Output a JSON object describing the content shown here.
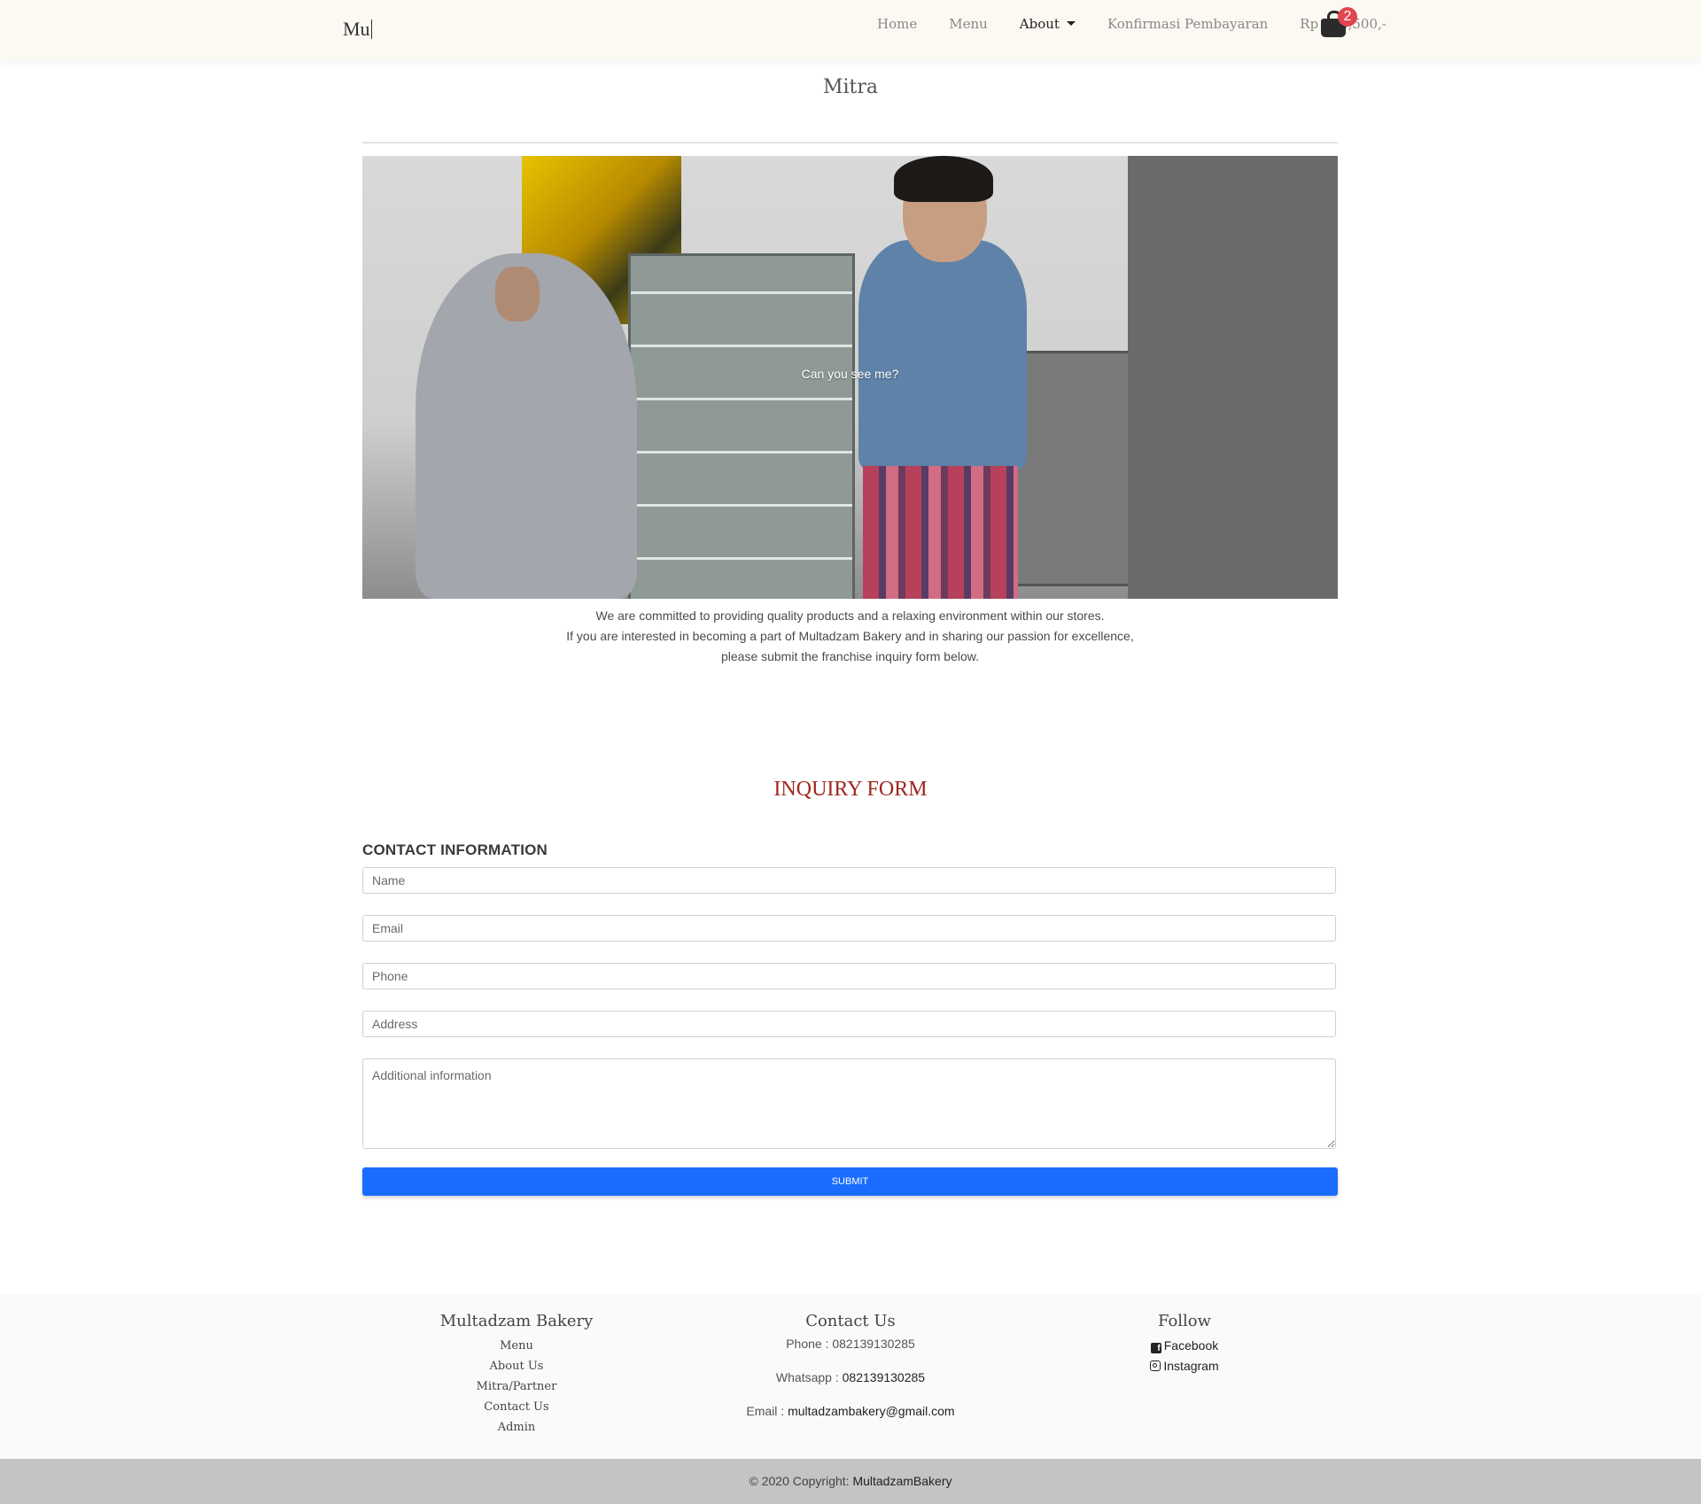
{
  "navbar": {
    "brand": "Mu",
    "items": [
      {
        "label": "Home"
      },
      {
        "label": "Menu"
      },
      {
        "label": "About"
      },
      {
        "label": "Konfirmasi Pembayaran"
      }
    ],
    "cart_total": "Rp 122,500,-",
    "cart_count": "2"
  },
  "page": {
    "title": "Mitra",
    "hero_caption": "Can you see me?",
    "intro_lines": [
      "We are committed to providing quality products and a relaxing environment within our stores.",
      "If you are interested in becoming a part of Multadzam Bakery and in sharing our passion for excellence,",
      "please submit the franchise inquiry form below."
    ]
  },
  "form": {
    "title": "INQUIRY FORM",
    "section_label": "CONTACT INFORMATION",
    "placeholders": {
      "name": "Name",
      "email": "Email",
      "phone": "Phone",
      "address": "Address",
      "additional": "Additional information"
    },
    "submit_label": "SUBMIT"
  },
  "footer": {
    "col1": {
      "title": "Multadzam Bakery",
      "links": [
        "Menu",
        "About Us",
        "Mitra/Partner",
        "Contact Us",
        "Admin"
      ]
    },
    "col2": {
      "title": "Contact Us",
      "phone_label": "Phone :",
      "phone": "082139130285",
      "whatsapp_label": "Whatsapp :",
      "whatsapp": "082139130285",
      "email_label": "Email :",
      "email": "multadzambakery@gmail.com"
    },
    "col3": {
      "title": "Follow",
      "facebook": "Facebook",
      "instagram": "Instagram"
    },
    "copyright_prefix": "© 2020 Copyright:",
    "copyright_brand": "MultadzamBakery"
  },
  "colors": {
    "accent": "#1a6cff",
    "form_title": "#a0271d",
    "badge": "#e04650",
    "navbar_bg": "#fcf9f3"
  },
  "icons": [
    "shopping-bag-icon",
    "dropdown-caret-icon",
    "facebook-icon",
    "instagram-icon"
  ]
}
